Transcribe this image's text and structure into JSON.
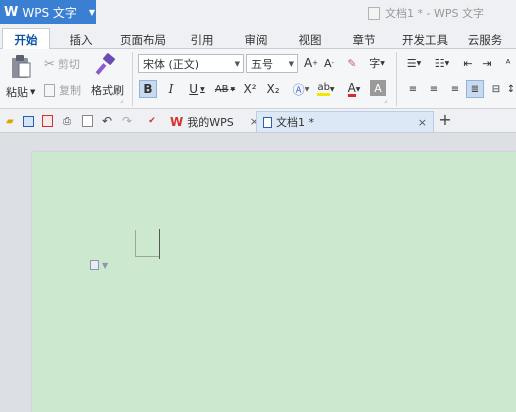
{
  "app": {
    "logo": "W",
    "name": "WPS 文字",
    "window_title": "文档1 * - WPS 文字"
  },
  "tabs": [
    "开始",
    "插入",
    "页面布局",
    "引用",
    "审阅",
    "视图",
    "章节",
    "开发工具",
    "云服务"
  ],
  "clipboard": {
    "paste": "粘贴",
    "cut": "剪切",
    "copy": "复制",
    "format_painter": "格式刷"
  },
  "font": {
    "name": "宋体 (正文)",
    "size": "五号"
  },
  "quick": {
    "doc_tabs": [
      {
        "label": "我的WPS",
        "close": "×"
      },
      {
        "label": "文档1 *",
        "close": "×"
      }
    ],
    "new_tab": "+"
  },
  "format": {
    "bold": "B",
    "italic": "I",
    "underline": "U",
    "strike": "AB",
    "superscript": "X²",
    "subscript": "X₂",
    "grow": "A",
    "shrink": "A"
  },
  "colors": {
    "accent": "#3b7fd3",
    "page": "#cce8cf",
    "highlight": "#f5e500",
    "font_color": "#d92a2a",
    "wps_red": "#d9312e"
  }
}
